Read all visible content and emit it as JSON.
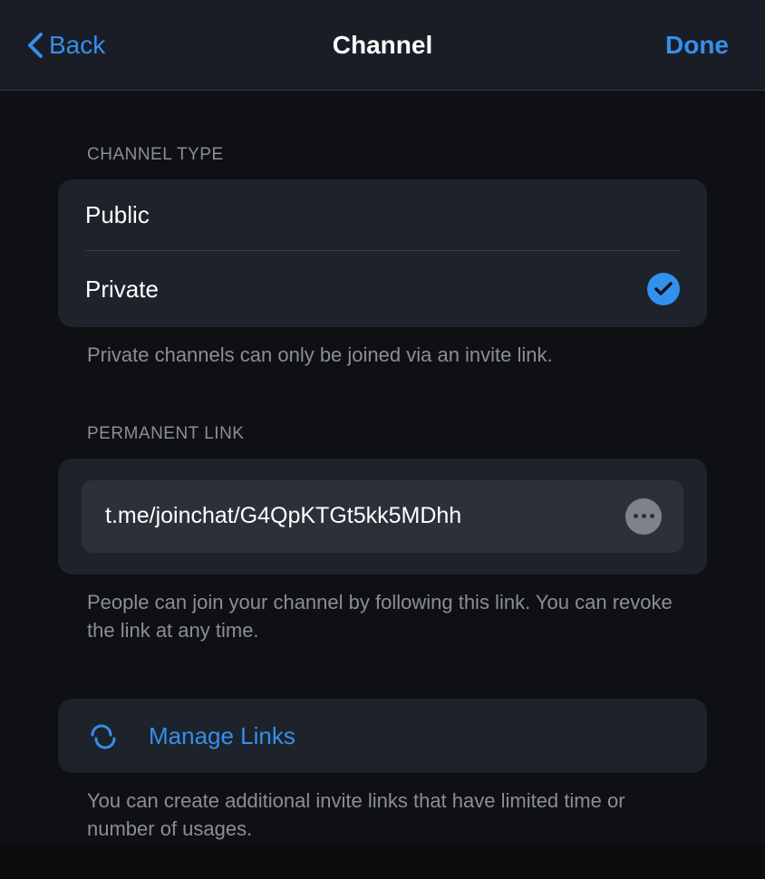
{
  "header": {
    "back_label": "Back",
    "title": "Channel",
    "done_label": "Done"
  },
  "channel_type": {
    "header": "CHANNEL TYPE",
    "options": [
      {
        "label": "Public",
        "selected": false
      },
      {
        "label": "Private",
        "selected": true
      }
    ],
    "footer": "Private channels can only be joined via an invite link."
  },
  "permanent_link": {
    "header": "PERMANENT LINK",
    "url": "t.me/joinchat/G4QpKTGt5kk5MDhh",
    "footer": "People can join your channel by following this link. You can revoke the link at any time."
  },
  "manage_links": {
    "label": "Manage Links",
    "footer": "You can create additional invite links that have limited time or number of usages."
  },
  "colors": {
    "accent": "#3390ec"
  }
}
